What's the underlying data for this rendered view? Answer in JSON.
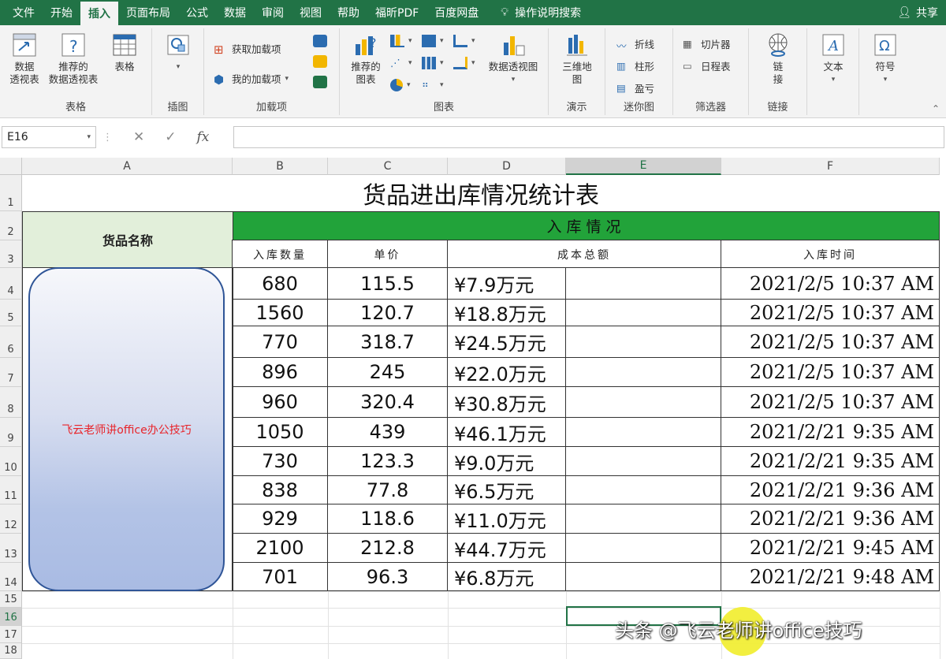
{
  "ribbon_tabs": [
    "文件",
    "开始",
    "插入",
    "页面布局",
    "公式",
    "数据",
    "审阅",
    "视图",
    "帮助",
    "福昕PDF",
    "百度网盘"
  ],
  "active_tab": "插入",
  "search_tell": "操作说明搜索",
  "share": "共享",
  "groups": {
    "tables": {
      "label": "表格",
      "pivot": "数据\n透视表",
      "recommended_pivot": "推荐的\n数据透视表",
      "table": "表格"
    },
    "illustrations": {
      "label": "插图"
    },
    "addins": {
      "label": "加载项",
      "get": "获取加载项",
      "my": "我的加载项"
    },
    "charts": {
      "label": "图表",
      "recommended": "推荐的\n图表",
      "pivot_chart": "数据透视图"
    },
    "tours": {
      "label": "演示",
      "map3d": "三维地\n图"
    },
    "sparklines": {
      "label": "迷你图",
      "line": "折线",
      "column": "柱形",
      "winloss": "盈亏"
    },
    "filters": {
      "label": "筛选器",
      "slicer": "切片器",
      "timeline": "日程表"
    },
    "links": {
      "label": "链接",
      "link": "链\n接"
    },
    "text": {
      "label": "",
      "text": "文本"
    },
    "symbols": {
      "label": "",
      "symbol": "符号"
    }
  },
  "formula_bar": {
    "name_box": "E16",
    "cancel": "✕",
    "enter": "✓",
    "fx": "fx",
    "formula": ""
  },
  "columns": [
    "A",
    "B",
    "C",
    "D",
    "E",
    "F"
  ],
  "rows": [
    "1",
    "2",
    "3",
    "4",
    "5",
    "6",
    "7",
    "8",
    "9",
    "10",
    "11",
    "12",
    "13",
    "14",
    "15",
    "16",
    "17",
    "18"
  ],
  "sheet": {
    "title": "货品进出库情况统计表",
    "name_header": "货品名称",
    "in_header": "入库情况",
    "sub_headers": [
      "入库数量",
      "单价",
      "成本总额",
      "入库时间"
    ],
    "shape_text": "飞云老师讲office办公技巧",
    "rows": [
      {
        "qty": "680",
        "price": "115.5",
        "cost": "¥7.9万元",
        "time": "2021/2/5 10:37 AM"
      },
      {
        "qty": "1560",
        "price": "120.7",
        "cost": "¥18.8万元",
        "time": "2021/2/5 10:37 AM"
      },
      {
        "qty": "770",
        "price": "318.7",
        "cost": "¥24.5万元",
        "time": "2021/2/5 10:37 AM"
      },
      {
        "qty": "896",
        "price": "245",
        "cost": "¥22.0万元",
        "time": "2021/2/5 10:37 AM"
      },
      {
        "qty": "960",
        "price": "320.4",
        "cost": "¥30.8万元",
        "time": "2021/2/5 10:37 AM"
      },
      {
        "qty": "1050",
        "price": "439",
        "cost": "¥46.1万元",
        "time": "2021/2/21 9:35 AM"
      },
      {
        "qty": "730",
        "price": "123.3",
        "cost": "¥9.0万元",
        "time": "2021/2/21 9:35 AM"
      },
      {
        "qty": "838",
        "price": "77.8",
        "cost": "¥6.5万元",
        "time": "2021/2/21 9:36 AM"
      },
      {
        "qty": "929",
        "price": "118.6",
        "cost": "¥11.0万元",
        "time": "2021/2/21 9:36 AM"
      },
      {
        "qty": "2100",
        "price": "212.8",
        "cost": "¥44.7万元",
        "time": "2021/2/21 9:45 AM"
      },
      {
        "qty": "701",
        "price": "96.3",
        "cost": "¥6.8万元",
        "time": "2021/2/21 9:48 AM"
      }
    ]
  },
  "watermark": "头条 @飞云老师讲office技巧",
  "colors": {
    "accent": "#217346",
    "header_green": "#22a33a",
    "name_header_bg": "#e2efda",
    "shape_border": "#2f5597",
    "shape_text": "#e8242a"
  }
}
